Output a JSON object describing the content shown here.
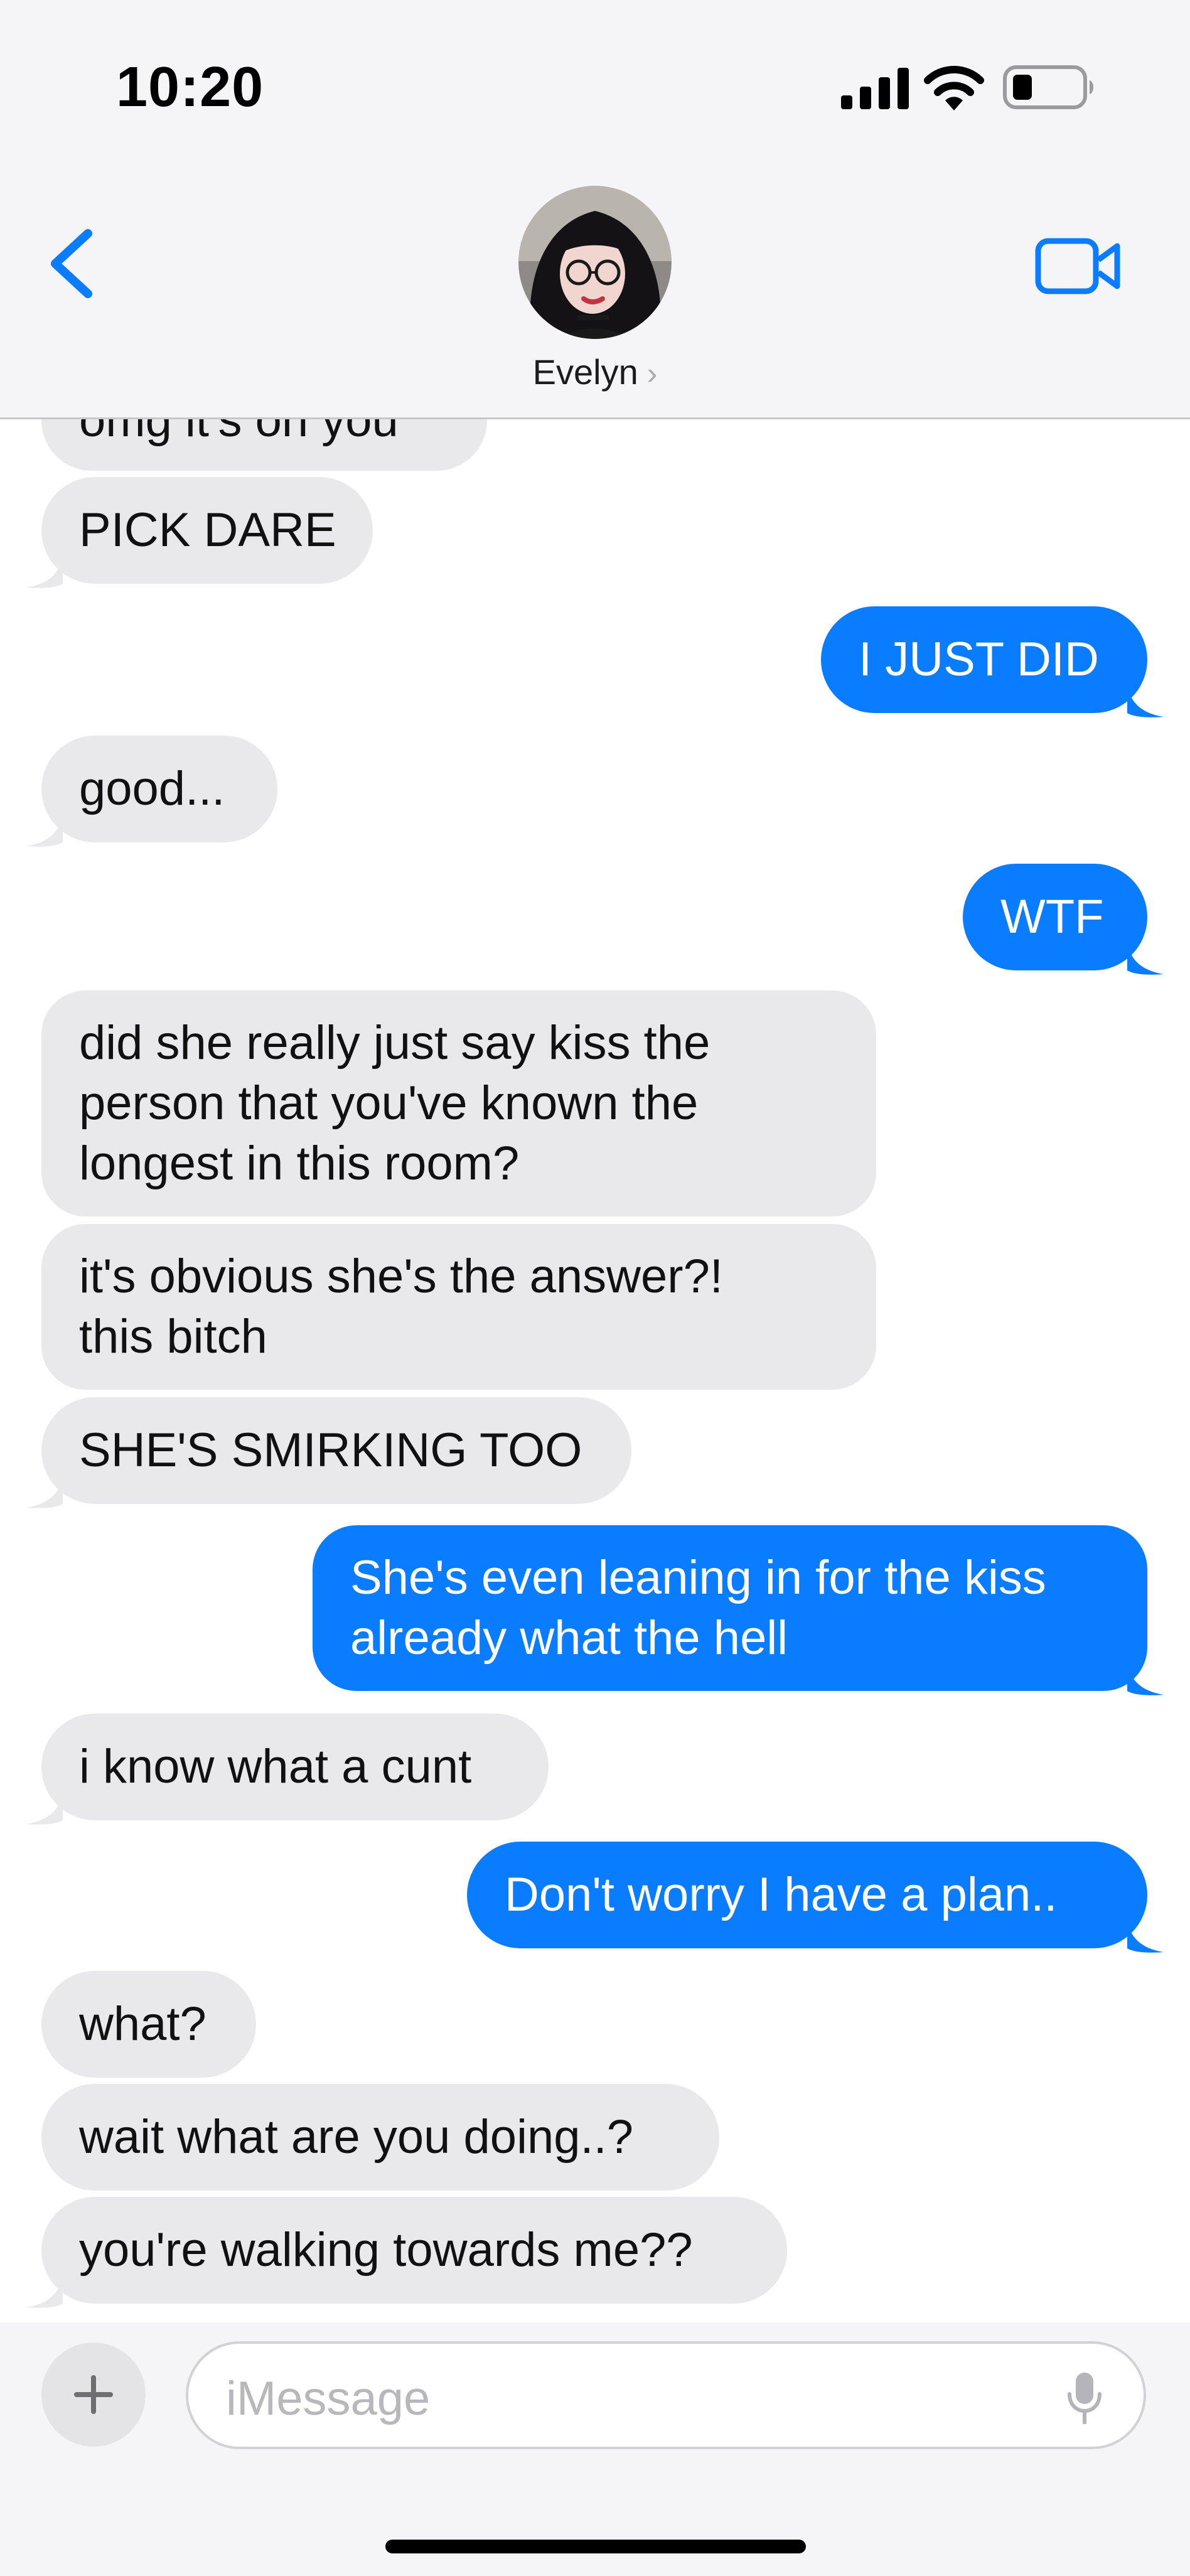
{
  "status_bar": {
    "time": "10:20"
  },
  "header": {
    "contact_name": "Evelyn",
    "chevron": "›"
  },
  "messages": [
    {
      "side": "in",
      "text": "omg it's on you"
    },
    {
      "side": "in",
      "text": "PICK DARE"
    },
    {
      "side": "out",
      "text": "I JUST DID"
    },
    {
      "side": "in",
      "text": "good..."
    },
    {
      "side": "out",
      "text": "WTF"
    },
    {
      "side": "in",
      "lines": [
        "did she really just say kiss the",
        "person that you've known the",
        "longest in this room?"
      ]
    },
    {
      "side": "in",
      "lines": [
        "it's obvious she's the answer?!",
        "this bitch"
      ]
    },
    {
      "side": "in",
      "text": "SHE'S SMIRKING TOO"
    },
    {
      "side": "out",
      "lines": [
        "She's even leaning in for the kiss",
        "already what the hell"
      ]
    },
    {
      "side": "in",
      "text": "i know what a cunt"
    },
    {
      "side": "out",
      "text": "Don't worry I have a plan.."
    },
    {
      "side": "in",
      "text": "what?"
    },
    {
      "side": "in",
      "text": "wait what are you doing..?"
    },
    {
      "side": "in",
      "text": "you're walking towards me??"
    }
  ],
  "input": {
    "placeholder": "iMessage",
    "plus_icon": "plus-icon",
    "mic_icon": "microphone-icon"
  },
  "colors": {
    "outgoing_bubble": "#0a7cff",
    "incoming_bubble": "#e9e9eb",
    "accent": "#0a7cff",
    "header_bg": "#f5f5f7"
  }
}
